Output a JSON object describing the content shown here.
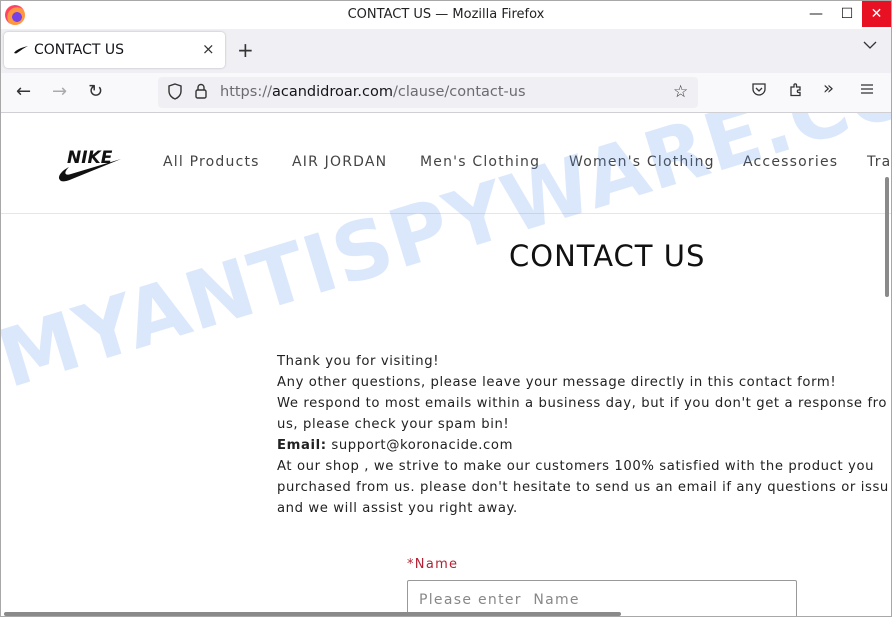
{
  "window": {
    "title": "CONTACT US — Mozilla Firefox",
    "controls": {
      "minimize": "—",
      "maximize": "☐",
      "close": "✕"
    }
  },
  "tabs": [
    {
      "label": "CONTACT US",
      "favicon": "nike-swoosh-icon",
      "close": "×",
      "active": true
    }
  ],
  "tabstrip": {
    "new_tab": "+",
    "list_all_tabs": "⌄"
  },
  "navbar": {
    "back": "←",
    "forward": "→",
    "reload": "↻",
    "url_scheme": "https://",
    "url_host": "acandidroar.com",
    "url_path": "/clause/contact-us",
    "bookmark_star": "☆",
    "toolbar_icons": [
      "pocket-icon",
      "extensions-icon",
      "overflow-icon",
      "menu-icon"
    ]
  },
  "site": {
    "brand": "NIKE",
    "nav": [
      "All Products",
      "AIR JORDAN",
      "Men's Clothing",
      "Women's Clothing",
      "Accessories",
      "Tra"
    ]
  },
  "main": {
    "heading": "CONTACT US",
    "lines": [
      "Thank you for visiting!",
      "Any other questions, please leave your message directly in this contact form!",
      "We respond to most emails within a business day, but if you don't get a response fro",
      "us, please check your spam bin!"
    ],
    "email_label": "Email:",
    "email_value": " support@koronacide.com",
    "lines2": [
      "At our shop , we strive to make our customers 100% satisfied with the product you",
      "purchased from us. please don't hesitate to send us an email if any questions or issu",
      "and we will assist you right away."
    ]
  },
  "form": {
    "name_label": "*Name",
    "name_placeholder": "Please enter  Name",
    "name_value": ""
  },
  "watermark": {
    "text": "MYANTISPYWARE.COM",
    "color": "#5a96eb"
  },
  "colors": {
    "required_label": "#b22234",
    "close_button": "#e81123"
  }
}
